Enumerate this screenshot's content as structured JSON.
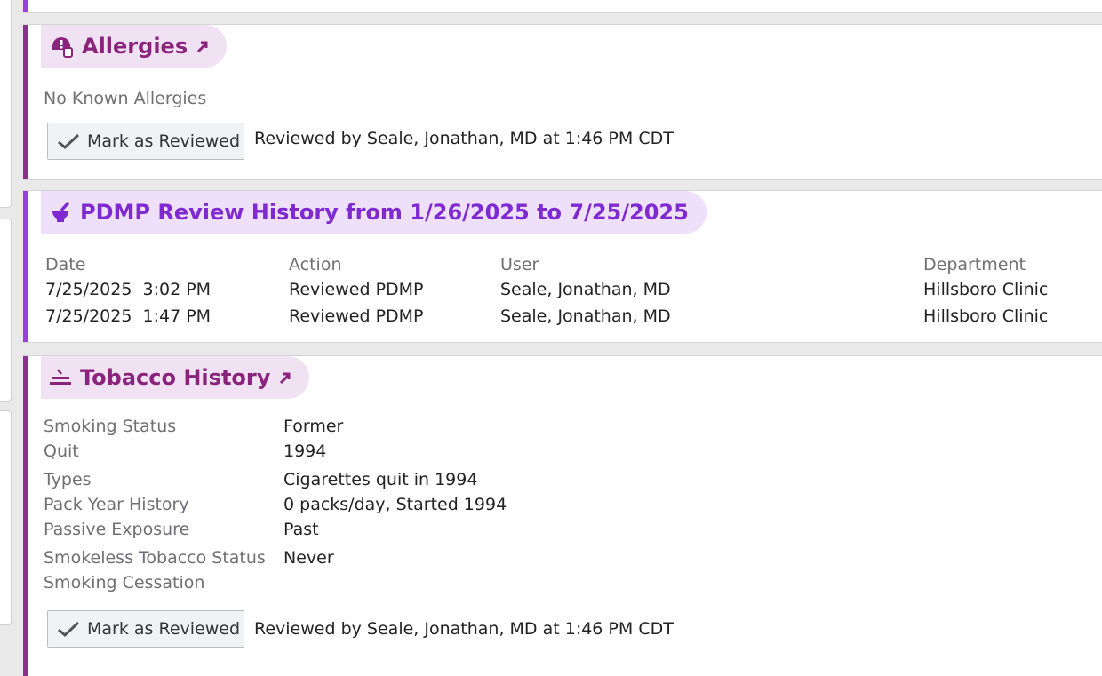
{
  "allergies": {
    "title": "Allergies",
    "icon": "allergy-alert-icon",
    "status_text": "No Known Allergies",
    "review_button_label": "Mark as Reviewed",
    "reviewed_text": "Reviewed by Seale, Jonathan, MD at 1:46 PM CDT"
  },
  "pdmp": {
    "title": "PDMP Review History from 1/26/2025 to 7/25/2025",
    "icon": "mortar-pestle-icon",
    "columns": [
      "Date",
      "Action",
      "User",
      "Department"
    ],
    "rows": [
      {
        "date": "7/25/2025  3:02 PM",
        "action": "Reviewed PDMP",
        "user": "Seale, Jonathan, MD",
        "department": "Hillsboro Clinic"
      },
      {
        "date": "7/25/2025  1:47 PM",
        "action": "Reviewed PDMP",
        "user": "Seale, Jonathan, MD",
        "department": "Hillsboro Clinic"
      }
    ]
  },
  "tobacco": {
    "title": "Tobacco History",
    "icon": "cigarette-icon",
    "fields": [
      {
        "label": "Smoking Status",
        "value": "Former"
      },
      {
        "label": "Quit",
        "value": "1994"
      },
      {
        "label": "Types",
        "value": "Cigarettes quit in 1994"
      },
      {
        "label": "Pack Year History",
        "value": "0 packs/day, Started 1994"
      },
      {
        "label": "Passive Exposure",
        "value": "Past"
      },
      {
        "label": "Smokeless Tobacco Status",
        "value": "Never"
      },
      {
        "label": "Smoking Cessation",
        "value": ""
      }
    ],
    "review_button_label": "Mark as Reviewed",
    "reviewed_text": "Reviewed by Seale, Jonathan, MD at 1:46 PM CDT"
  },
  "colors": {
    "section_accent": "#8c2f8f",
    "pdmp_accent": "#9b3fe0",
    "pill_bg": "#f1e2f3",
    "pdmp_pill_bg": "#eee0fb"
  }
}
